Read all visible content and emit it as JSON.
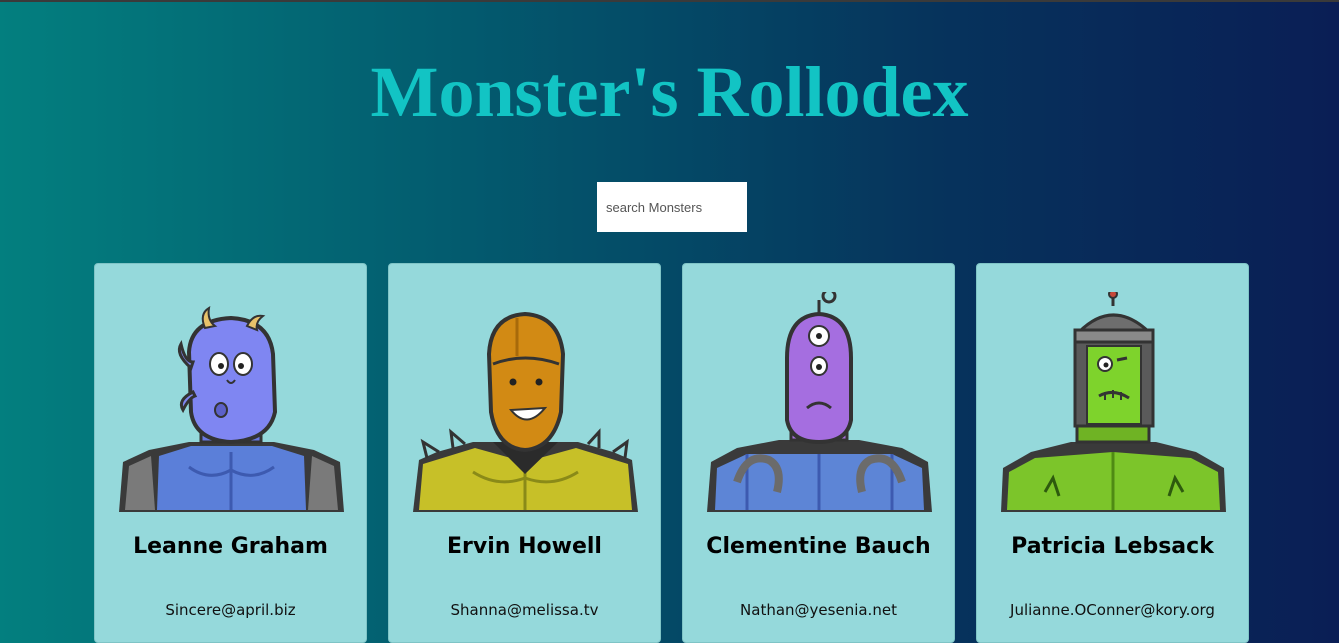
{
  "app": {
    "title": "Monster's Rollodex"
  },
  "search": {
    "placeholder": "search Monsters",
    "value": ""
  },
  "monsters": [
    {
      "name": "Leanne Graham",
      "email": "Sincere@april.biz",
      "avatar_icon": "blue-horned-monster-icon"
    },
    {
      "name": "Ervin Howell",
      "email": "Shanna@melissa.tv",
      "avatar_icon": "orange-spiky-monster-icon"
    },
    {
      "name": "Clementine Bauch",
      "email": "Nathan@yesenia.net",
      "avatar_icon": "purple-cyclops-robot-monster-icon"
    },
    {
      "name": "Patricia Lebsack",
      "email": "Julianne.OConner@kory.org",
      "avatar_icon": "green-frankenstein-robot-monster-icon"
    }
  ],
  "colors": {
    "title": "#12c4c4",
    "card_background": "#95d9db",
    "gradient_start": "#037f7f",
    "gradient_end": "#0a1e55"
  }
}
